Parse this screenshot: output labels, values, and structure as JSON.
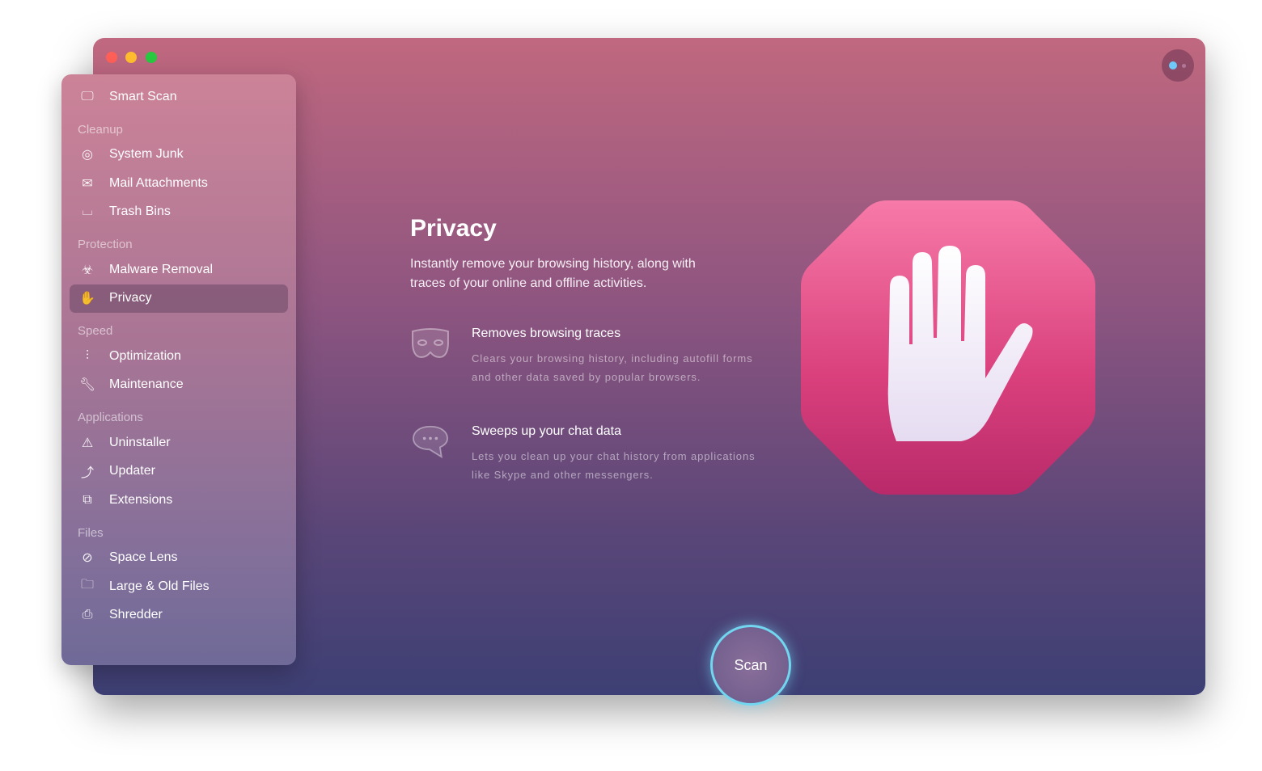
{
  "window": {
    "traffic_lights": {
      "close": "#fe5f57",
      "minimize": "#febc2e",
      "zoom": "#28c840"
    }
  },
  "sidebar": {
    "smart_scan": "Smart Scan",
    "sections": [
      {
        "header": "Cleanup",
        "items": [
          "System Junk",
          "Mail Attachments",
          "Trash Bins"
        ]
      },
      {
        "header": "Protection",
        "items": [
          "Malware Removal",
          "Privacy"
        ]
      },
      {
        "header": "Speed",
        "items": [
          "Optimization",
          "Maintenance"
        ]
      },
      {
        "header": "Applications",
        "items": [
          "Uninstaller",
          "Updater",
          "Extensions"
        ]
      },
      {
        "header": "Files",
        "items": [
          "Space Lens",
          "Large & Old Files",
          "Shredder"
        ]
      }
    ],
    "active": "Privacy"
  },
  "main": {
    "title": "Privacy",
    "subtitle": "Instantly remove your browsing history, along with traces of your online and offline activities.",
    "features": [
      {
        "icon": "mask-icon",
        "title": "Removes browsing traces",
        "desc": "Clears your browsing history, including autofill forms and other data saved by popular browsers."
      },
      {
        "icon": "chat-bubble-icon",
        "title": "Sweeps up your chat data",
        "desc": "Lets you clean up your chat history from applications like Skype and other messengers."
      }
    ],
    "hero_icon": "stop-hand-icon",
    "scan_label": "Scan"
  },
  "colors": {
    "accent_ring": "#73d6f0",
    "octagon": "#e0508a"
  }
}
